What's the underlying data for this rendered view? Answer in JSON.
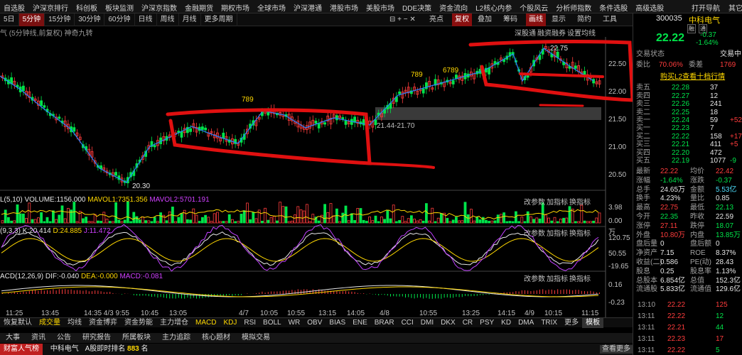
{
  "top_menu": [
    "自选股",
    "沪深京排行",
    "科创板",
    "板块监测",
    "沪深京指数",
    "金融期货",
    "期权市场",
    "全球市场",
    "沪深港通",
    "港股市场",
    "美股市场",
    "DDE决策",
    "资金流向",
    "L2核心内参",
    "个股风云",
    "分析师指数",
    "条件选股",
    "高级选股"
  ],
  "top_right": {
    "nav": "打开导航",
    "misc": "其它"
  },
  "periods": [
    "5日",
    "5分钟",
    "15分钟",
    "30分钟",
    "60分钟",
    "日线",
    "周线",
    "月线",
    "更多周期"
  ],
  "active_period": "5分钟",
  "toolbar_right": [
    "亮点",
    "复权",
    "叠加",
    "筹码",
    "画线",
    "显示",
    "简约",
    "工具"
  ],
  "chart_subtitle": "气 (5分钟线,前复权)  神奇九转",
  "chart_right_links": [
    "深股通",
    "融资融券",
    "设置均线"
  ],
  "price_annotations": {
    "high": "22.75",
    "low": "20.30",
    "range": "21.44-21.70",
    "label_789a": "789",
    "label_789b": "789",
    "label_6789": "6789"
  },
  "price_axis": [
    "22.50",
    "22.00",
    "21.50",
    "21.00",
    "20.50"
  ],
  "volume_header": {
    "prefix": "L(5,10)",
    "volume": "VOLUME:1156.000",
    "mavol1": "MAVOL1:7351.356",
    "mavol2": "MAVOL2:5701.191"
  },
  "volume_axis": [
    "3.98",
    "0.00"
  ],
  "volume_unit": "万",
  "kdj_header": {
    "prefix": "(9,3,3)",
    "k": "K:20.414",
    "d": "D:24.885",
    "j": "J:11.472"
  },
  "kdj_axis": [
    "120.75",
    "50.55",
    "-19.65"
  ],
  "macd_header": {
    "prefix": "ACD(12,26,9)",
    "dif": "DIF:-0.040",
    "dea": "DEA:-0.000",
    "macd": "MACD:-0.081"
  },
  "macd_axis": [
    "0.16",
    "-0.23"
  ],
  "panel_buttons": [
    "改参数",
    "加指标",
    "换指标"
  ],
  "time_axis": [
    "11:25",
    "13:45",
    "14:35 4/3 9:55",
    "10:45",
    "13:05",
    "4/7",
    "10:05",
    "10:55",
    "13:15",
    "14:05",
    "4/8",
    "10:55",
    "13:25",
    "14:15",
    "4/9",
    "10:15",
    "11:15"
  ],
  "indicator_tabs": [
    "恢复默认",
    "成交量",
    "均线",
    "资金博弈",
    "资金势能",
    "主力增仓",
    "MACD",
    "KDJ",
    "RSI",
    "BOLL",
    "WR",
    "OBV",
    "BIAS",
    "ENE",
    "BRAR",
    "CCI",
    "DMI",
    "DKX",
    "CR",
    "PSY",
    "KD",
    "DMA",
    "TRIX",
    "更多",
    "模板"
  ],
  "bottom_nav": [
    "大事",
    "资讯",
    "公告",
    "研究报告",
    "所属板块",
    "主力追踪",
    "核心题材",
    "模拟交易"
  ],
  "status_bar": {
    "brand": "财富人气榜",
    "stock": "中科电气",
    "rank_label": "A股即时排名",
    "rank": "883",
    "rank_unit": "名",
    "more": "查看更多"
  },
  "quote": {
    "code": "300035",
    "name": "中科电气",
    "tag1": "融",
    "tag2": "通",
    "price": "22.22",
    "change": "-0.37",
    "change_pct": "-1.64%",
    "status_label": "交易状态",
    "status_value": "交易中",
    "wb_label": "委比",
    "wb_value": "70.06%",
    "wc_label": "委差",
    "wc_value": "1769",
    "l2_link": "购买L2查看十档行情",
    "asks": [
      {
        "label": "卖五",
        "price": "22.28",
        "vol": "37",
        "chg": ""
      },
      {
        "label": "卖四",
        "price": "22.27",
        "vol": "12",
        "chg": ""
      },
      {
        "label": "卖三",
        "price": "22.26",
        "vol": "241",
        "chg": ""
      },
      {
        "label": "卖二",
        "price": "22.25",
        "vol": "18",
        "chg": ""
      },
      {
        "label": "卖一",
        "price": "22.24",
        "vol": "59",
        "chg": "+52"
      }
    ],
    "bids": [
      {
        "label": "买一",
        "price": "22.23",
        "vol": "7",
        "chg": ""
      },
      {
        "label": "买二",
        "price": "22.22",
        "vol": "158",
        "chg": "+17"
      },
      {
        "label": "买三",
        "price": "22.21",
        "vol": "411",
        "chg": "+5"
      },
      {
        "label": "买四",
        "price": "22.20",
        "vol": "472",
        "chg": ""
      },
      {
        "label": "买五",
        "price": "22.19",
        "vol": "1077",
        "chg": "-9"
      }
    ],
    "stats": [
      {
        "l1": "最新",
        "v1": "22.22",
        "c1": "up",
        "l2": "均价",
        "v2": "22.42",
        "c2": "up"
      },
      {
        "l1": "涨幅",
        "v1": "-1.64%",
        "c1": "dn",
        "l2": "涨跌",
        "v2": "-0.37",
        "c2": "dn"
      },
      {
        "l1": "总手",
        "v1": "24.65万",
        "c1": "wh",
        "l2": "金额",
        "v2": "5.53亿",
        "c2": "cy"
      },
      {
        "l1": "换手",
        "v1": "4.23%",
        "c1": "wh",
        "l2": "量比",
        "v2": "0.85",
        "c2": "wh"
      },
      {
        "l1": "最高",
        "v1": "22.75",
        "c1": "up",
        "l2": "最低",
        "v2": "22.13",
        "c2": "dn"
      },
      {
        "l1": "今开",
        "v1": "22.35",
        "c1": "dn",
        "l2": "昨收",
        "v2": "22.59",
        "c2": "wh"
      },
      {
        "l1": "涨停",
        "v1": "27.11",
        "c1": "up",
        "l2": "跌停",
        "v2": "18.07",
        "c2": "dn"
      },
      {
        "l1": "外盘",
        "v1": "10.80万",
        "c1": "up",
        "l2": "内盘",
        "v2": "13.85万",
        "c2": "dn"
      },
      {
        "l1": "盘后量",
        "v1": "0",
        "c1": "wh",
        "l2": "盘后额",
        "v2": "0",
        "c2": "wh"
      },
      {
        "l1": "净资产",
        "v1": "7.15",
        "c1": "wh",
        "l2": "ROE",
        "v2": "8.37%",
        "c2": "wh"
      },
      {
        "l1": "收益(二)",
        "v1": "0.586",
        "c1": "wh",
        "l2": "PE(动)",
        "v2": "28.43",
        "c2": "wh"
      },
      {
        "l1": "股息",
        "v1": "0.25",
        "c1": "wh",
        "l2": "股息率",
        "v2": "1.13%",
        "c2": "wh"
      },
      {
        "l1": "总股本",
        "v1": "6.854亿",
        "c1": "wh",
        "l2": "总值",
        "v2": "152.3亿",
        "c2": "wh"
      },
      {
        "l1": "流通股",
        "v1": "5.833亿",
        "c1": "wh",
        "l2": "流通值",
        "v2": "129.6亿",
        "c2": "wh"
      }
    ],
    "ticks": [
      {
        "time": "13:10",
        "price": "22.22",
        "vol": "125",
        "vol_color": "up"
      },
      {
        "time": "13:11",
        "price": "22.22",
        "vol": "12",
        "vol_color": "dn"
      },
      {
        "time": "13:11",
        "price": "22.21",
        "vol": "44",
        "vol_color": "dn"
      },
      {
        "time": "13:11",
        "price": "22.23",
        "vol": "17",
        "vol_color": "up"
      },
      {
        "time": "13:11",
        "price": "22.22",
        "vol": "5",
        "vol_color": "dn"
      }
    ]
  },
  "colors": {
    "up": "#ff3c3c",
    "down": "#00e44a",
    "bg": "#000000",
    "marker": "#e01010",
    "trend": "#2a7fff"
  }
}
